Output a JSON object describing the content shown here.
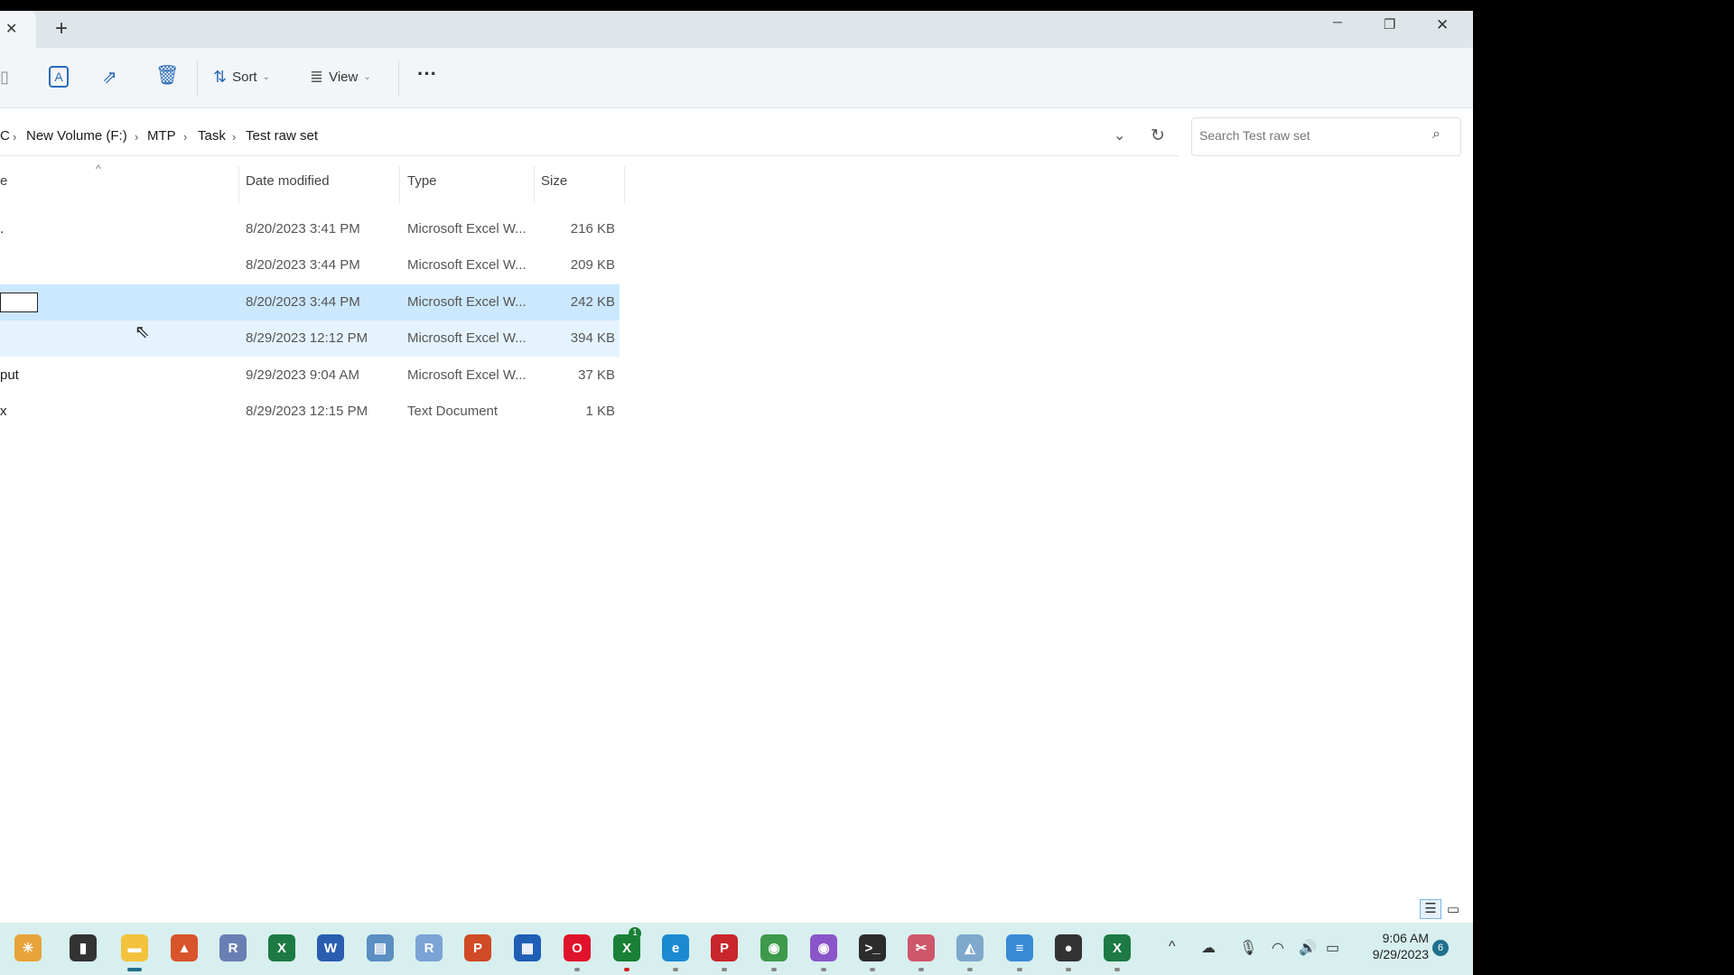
{
  "tabs": {
    "new_tab": "+",
    "close": "✕"
  },
  "window": {
    "minimize": "─",
    "maximize": "❐",
    "close": "✕"
  },
  "toolbar": {
    "sort": "Sort",
    "view": "View",
    "more": "···"
  },
  "breadcrumb": [
    "C",
    "New Volume (F:)",
    "MTP",
    "Task",
    "Test raw set"
  ],
  "search": {
    "placeholder": "Search Test raw set"
  },
  "columns": {
    "date": "Date modified",
    "type": "Type",
    "size": "Size",
    "name_partial": "e"
  },
  "rows": [
    {
      "name": ".",
      "date": "8/20/2023 3:41 PM",
      "type": "Microsoft Excel W...",
      "size": "216 KB",
      "state": "normal"
    },
    {
      "name": "",
      "date": "8/20/2023 3:44 PM",
      "type": "Microsoft Excel W...",
      "size": "209 KB",
      "state": "normal"
    },
    {
      "name": "",
      "date": "8/20/2023 3:44 PM",
      "type": "Microsoft Excel W...",
      "size": "242 KB",
      "state": "selected-renaming"
    },
    {
      "name": "",
      "date": "8/29/2023 12:12 PM",
      "type": "Microsoft Excel W...",
      "size": "394 KB",
      "state": "hover"
    },
    {
      "name": "put",
      "date": "9/29/2023 9:04 AM",
      "type": "Microsoft Excel W...",
      "size": "37 KB",
      "state": "normal"
    },
    {
      "name": "x",
      "date": "8/29/2023 12:15 PM",
      "type": "Text Document",
      "size": "1 KB",
      "state": "normal"
    }
  ],
  "taskbar": {
    "apps": [
      {
        "name": "widgets",
        "glyph": "☀",
        "color": "#e8a33a"
      },
      {
        "name": "task-view",
        "glyph": "▮",
        "color": "#333333"
      },
      {
        "name": "file-explorer",
        "glyph": "▬",
        "color": "#f2c23c"
      },
      {
        "name": "matlab",
        "glyph": "▲",
        "color": "#d8542a"
      },
      {
        "name": "r",
        "glyph": "R",
        "color": "#6a7fb3"
      },
      {
        "name": "excel",
        "glyph": "X",
        "color": "#1d7a43"
      },
      {
        "name": "word",
        "glyph": "W",
        "color": "#2a5db0"
      },
      {
        "name": "python-idle",
        "glyph": "▤",
        "color": "#5b8ec2"
      },
      {
        "name": "rstudio",
        "glyph": "R",
        "color": "#7aa3d6"
      },
      {
        "name": "powerpoint",
        "glyph": "P",
        "color": "#d04a26"
      },
      {
        "name": "microsoft-store",
        "glyph": "▦",
        "color": "#1f5fb5"
      },
      {
        "name": "opera",
        "glyph": "O",
        "color": "#e0122b"
      },
      {
        "name": "xbox",
        "glyph": "X",
        "color": "#1a7f37"
      },
      {
        "name": "edge",
        "glyph": "e",
        "color": "#1c8ad2"
      },
      {
        "name": "acrobat",
        "glyph": "P",
        "color": "#c8262b"
      },
      {
        "name": "chrome",
        "glyph": "◉",
        "color": "#3c9a4a"
      },
      {
        "name": "chrome-profile",
        "glyph": "◉",
        "color": "#8a55c8"
      },
      {
        "name": "terminal",
        "glyph": ">_",
        "color": "#2c2c2c"
      },
      {
        "name": "snipping-tool",
        "glyph": "✂",
        "color": "#d0566a"
      },
      {
        "name": "image-viewer",
        "glyph": "◭",
        "color": "#7ea8cc"
      },
      {
        "name": "notepad",
        "glyph": "≡",
        "color": "#3a8ad6"
      },
      {
        "name": "obs",
        "glyph": "●",
        "color": "#333333"
      },
      {
        "name": "excel-2",
        "glyph": "X",
        "color": "#1d7a43"
      }
    ],
    "badge_xbox": "1",
    "tray": {
      "chevron": "^",
      "time": "9:06 AM",
      "date": "9/29/2023",
      "notifications": "6"
    }
  }
}
